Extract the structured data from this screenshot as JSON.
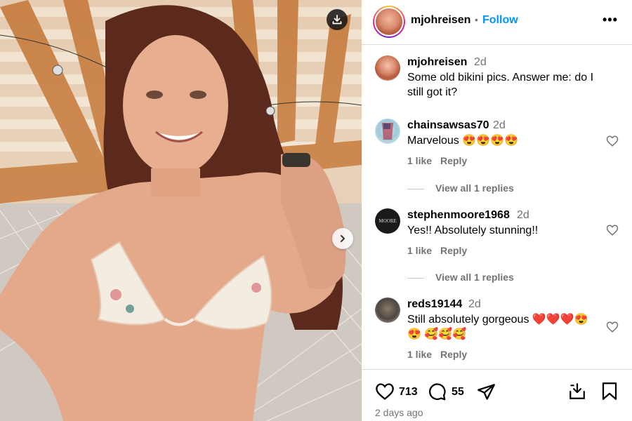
{
  "post": {
    "username": "mjohreisen",
    "follow_label": "Follow",
    "dot": "•",
    "more_label": "•••"
  },
  "caption": {
    "username": "mjohreisen",
    "time": "2d",
    "text": "Some old bikini pics. Answer me: do I still got it?"
  },
  "comments": [
    {
      "username": "chainsawsas70",
      "time": "2d",
      "text": "Marvelous 😍😍😍😍",
      "likes_label": "1 like",
      "reply_label": "Reply",
      "view_replies": "View all 1 replies"
    },
    {
      "username": "stephenmoore1968",
      "time": "2d",
      "text": "Yes!! Absolutely stunning!!",
      "likes_label": "1 like",
      "reply_label": "Reply",
      "view_replies": "View all 1 replies",
      "avatar_text": "MOORE"
    },
    {
      "username": "reds19144",
      "time": "2d",
      "text": "Still absolutely gorgeous ❤️❤️❤️😍😍 🥰🥰🥰",
      "likes_label": "1 like",
      "reply_label": "Reply"
    }
  ],
  "actions": {
    "like_count": "713",
    "comment_count": "55",
    "posted": "2 days ago"
  },
  "icons": {
    "download": "download-icon",
    "next": "chevron-right-icon",
    "heart": "heart-icon",
    "comment": "comment-icon",
    "share": "send-icon",
    "save_to_collection": "download-tray-icon",
    "bookmark": "bookmark-icon"
  },
  "colors": {
    "accent": "#0095f6",
    "muted": "#737373",
    "border": "#dbdbdb"
  }
}
